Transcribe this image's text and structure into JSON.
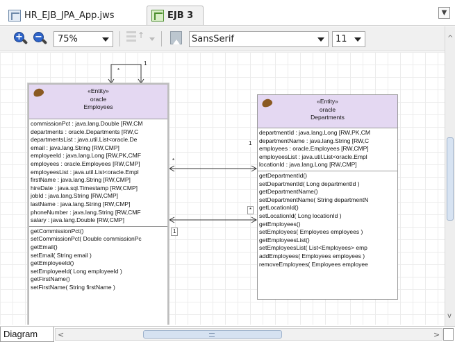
{
  "tabs": [
    {
      "label": "HR_EJB_JPA_App.jws",
      "icon": "project-icon",
      "active": false
    },
    {
      "label": "EJB 3",
      "icon": "ejb-diagram-icon",
      "active": true
    }
  ],
  "toolbar": {
    "zoom_value": "75%",
    "font_value": "SansSerif",
    "size_value": "11"
  },
  "employees": {
    "stereotype": "«Entity»",
    "schema": "oracle",
    "name": "Employees",
    "attributes": [
      "commissionPct : java.lang.Double [RW,CM",
      "departments : oracle.Departments [RW,C",
      "departmentsList : java.util.List<oracle.De",
      "email : java.lang.String [RW,CMP]",
      "employeeId : java.lang.Long [RW,PK,CMF",
      "employees : oracle.Employees [RW,CMP]",
      "employeesList : java.util.List<oracle.Empl",
      "firstName : java.lang.String [RW,CMP]",
      "hireDate : java.sql.Timestamp [RW,CMP]",
      "jobId : java.lang.String [RW,CMP]",
      "lastName : java.lang.String [RW,CMP]",
      "phoneNumber : java.lang.String [RW,CMF",
      "salary : java.lang.Double [RW,CMP]"
    ],
    "methods": [
      "getCommissionPct()",
      "setCommissionPct( Double commissionPc",
      "getEmail()",
      "setEmail( String email )",
      "getEmployeeId()",
      "setEmployeeId( Long employeeId )",
      "getFirstName()",
      "setFirstName( String firstName )"
    ]
  },
  "departments": {
    "stereotype": "«Entity»",
    "schema": "oracle",
    "name": "Departments",
    "attributes": [
      "departmentId : java.lang.Long [RW,PK,CM",
      "departmentName : java.lang.String [RW,C",
      "employees : oracle.Employees [RW,CMP]",
      "employeesList : java.util.List<oracle.Empl",
      "locationId : java.lang.Long [RW,CMP]"
    ],
    "methods": [
      "getDepartmentId()",
      "setDepartmentId( Long departmentId )",
      "getDepartmentName()",
      "setDepartmentName( String departmentN",
      "getLocationId()",
      "setLocationId( Long locationId )",
      "getEmployees()",
      "setEmployees( Employees employees )",
      "getEmployeesList()",
      "setEmployeesList( List<Employees> emp",
      "addEmployees( Employees employees )",
      "removeEmployees( Employees employee"
    ]
  },
  "multiplicities": {
    "self_many": "*",
    "self_one": "1",
    "assoc1_emp": "*",
    "assoc1_dep": "1",
    "assoc2_emp": "1",
    "assoc2_dep": "*"
  },
  "bottom": {
    "diagram_tab": "Diagram"
  }
}
